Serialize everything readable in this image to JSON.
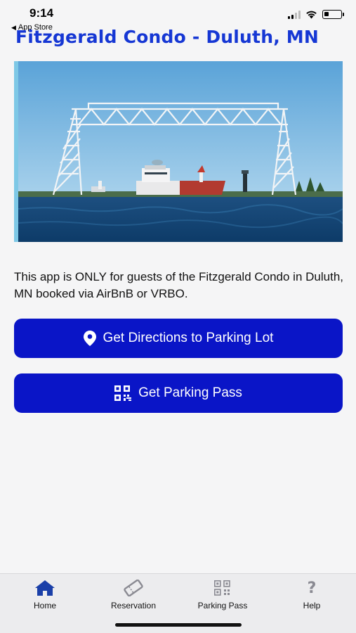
{
  "status_bar": {
    "time": "9:14",
    "back_label": "App Store"
  },
  "header": {
    "title": "Fitzgerald Condo - Duluth, MN"
  },
  "hero": {
    "icon": "aerial-lift-bridge-photo"
  },
  "intro": {
    "text": "This app is ONLY for guests of the Fitzgerald Condo in Duluth, MN booked via AirBnB or VRBO."
  },
  "actions": {
    "directions_label": "Get Directions to Parking Lot",
    "directions_icon": "map-pin-icon",
    "pass_label": "Get Parking Pass",
    "pass_icon": "qr-code-icon"
  },
  "tabs": [
    {
      "label": "Home",
      "icon": "home-icon",
      "active": true
    },
    {
      "label": "Reservation",
      "icon": "ticket-icon",
      "active": false
    },
    {
      "label": "Parking Pass",
      "icon": "qr-code-icon",
      "active": false
    },
    {
      "label": "Help",
      "icon": "question-icon",
      "active": false
    }
  ],
  "colors": {
    "title": "#1637d4",
    "button": "#0a15c7",
    "active_tab_icon": "#1a3fa8",
    "inactive_tab_icon": "#8a8a92"
  }
}
